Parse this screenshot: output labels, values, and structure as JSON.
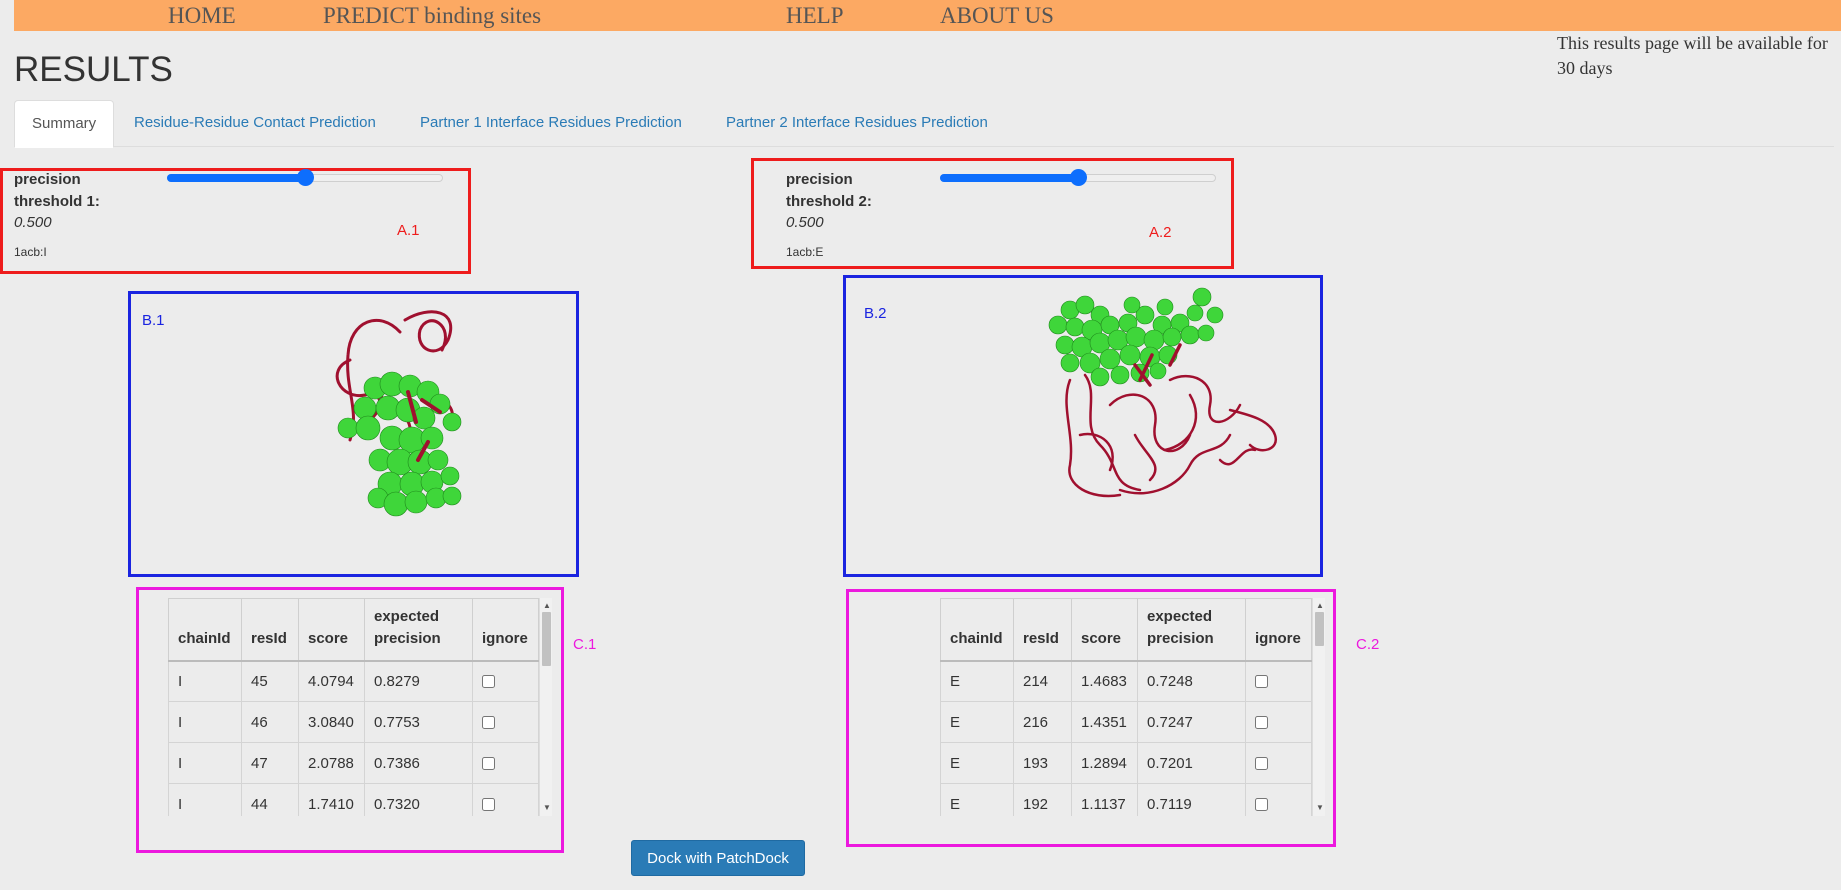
{
  "nav": {
    "items": [
      "HOME",
      "PREDICT binding sites",
      "HELP",
      "ABOUT US"
    ],
    "notice": "This results page will be available for 30 days"
  },
  "page_title": "RESULTS",
  "tabs": [
    {
      "label": "Summary",
      "active": true
    },
    {
      "label": "Residue-Residue Contact Prediction",
      "active": false
    },
    {
      "label": "Partner 1 Interface Residues Prediction",
      "active": false
    },
    {
      "label": "Partner 2 Interface Residues Prediction",
      "active": false
    }
  ],
  "partner1": {
    "threshold_label": "precision threshold 1:",
    "threshold_value": "0.500",
    "slider_level": 0.5,
    "chain": "1acb:I",
    "annotations": {
      "threshold": "A.1",
      "viewer": "B.1",
      "table": "C.1"
    },
    "table": {
      "headers": [
        "chainId",
        "resId",
        "score",
        "expected precision",
        "ignore"
      ],
      "rows": [
        [
          "I",
          "45",
          "4.0794",
          "0.8279"
        ],
        [
          "I",
          "46",
          "3.0840",
          "0.7753"
        ],
        [
          "I",
          "47",
          "2.0788",
          "0.7386"
        ],
        [
          "I",
          "44",
          "1.7410",
          "0.7320"
        ]
      ]
    }
  },
  "partner2": {
    "threshold_label": "precision threshold 2:",
    "threshold_value": "0.500",
    "slider_level": 0.5,
    "chain": "1acb:E",
    "annotations": {
      "threshold": "A.2",
      "viewer": "B.2",
      "table": "C.2"
    },
    "table": {
      "headers": [
        "chainId",
        "resId",
        "score",
        "expected precision",
        "ignore"
      ],
      "rows": [
        [
          "E",
          "214",
          "1.4683",
          "0.7248"
        ],
        [
          "E",
          "216",
          "1.4351",
          "0.7247"
        ],
        [
          "E",
          "193",
          "1.2894",
          "0.7201"
        ],
        [
          "E",
          "192",
          "1.1137",
          "0.7119"
        ]
      ]
    }
  },
  "dock_button": "Dock with PatchDock",
  "colors": {
    "nav_bg": "#fca963",
    "link": "#2a7bb6",
    "slider": "#0d6efd",
    "box_red": "#ee1c1c",
    "box_blue": "#1a24e0",
    "box_magenta": "#ec19de",
    "ribbon": "#a0102f",
    "sphere": "#3fd63a"
  }
}
